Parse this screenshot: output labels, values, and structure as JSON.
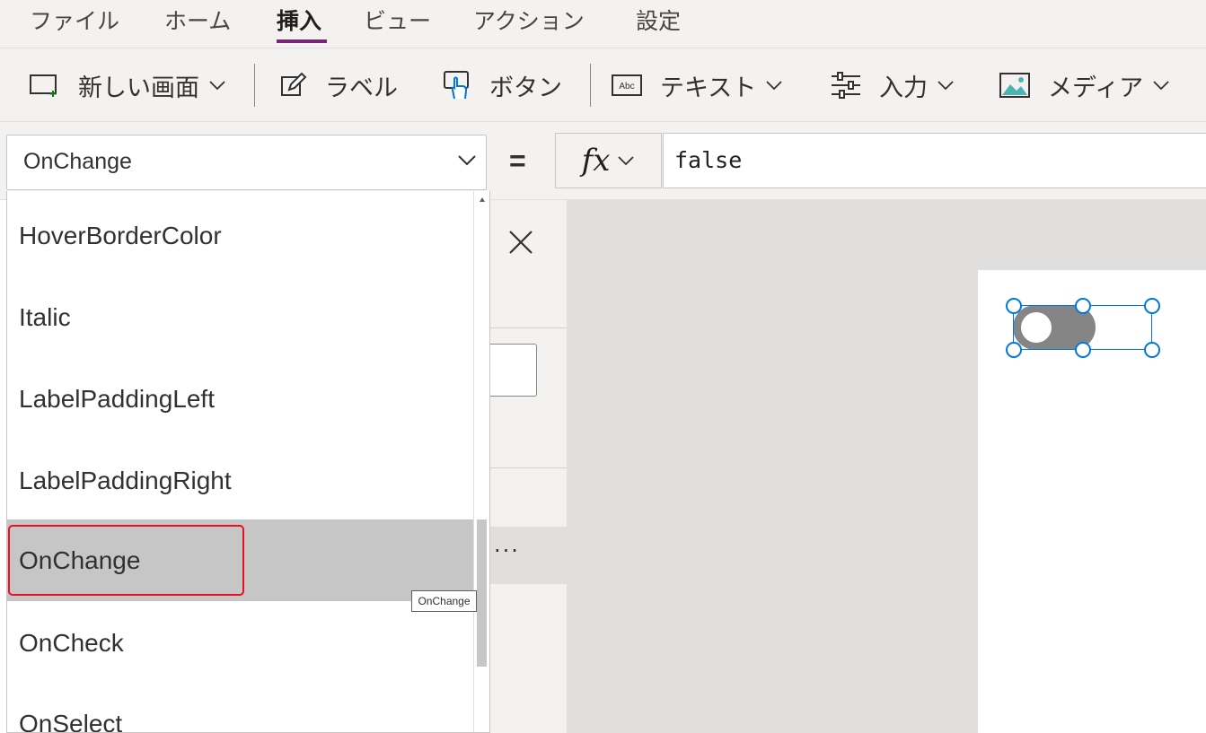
{
  "menu": {
    "items": [
      {
        "label": "ファイル",
        "active": false
      },
      {
        "label": "ホーム",
        "active": false
      },
      {
        "label": "挿入",
        "active": true
      },
      {
        "label": "ビュー",
        "active": false
      },
      {
        "label": "アクション",
        "active": false
      },
      {
        "label": "設定",
        "active": false
      }
    ],
    "accent_color": "#742774"
  },
  "ribbon": {
    "new_screen": "新しい画面",
    "label": "ラベル",
    "button": "ボタン",
    "text": "テキスト",
    "input": "入力",
    "media": "メディア",
    "text_icon_caption": "Abc"
  },
  "formula_bar": {
    "property": "OnChange",
    "equals": "=",
    "fx": "fx",
    "formula": "false"
  },
  "property_list": {
    "items": [
      {
        "label": "HoverBorderColor",
        "selected": false
      },
      {
        "label": "Italic",
        "selected": false
      },
      {
        "label": "LabelPaddingLeft",
        "selected": false
      },
      {
        "label": "LabelPaddingRight",
        "selected": false
      },
      {
        "label": "OnChange",
        "selected": true
      },
      {
        "label": "OnCheck",
        "selected": false
      },
      {
        "label": "OnSelect",
        "selected": false
      }
    ],
    "tooltip": "OnChange"
  },
  "panel": {
    "more": "···"
  },
  "canvas": {
    "toggle_value": false,
    "toggle_color": "#858585",
    "selection_color": "#0078d4"
  },
  "highlight_color": "#e81123"
}
